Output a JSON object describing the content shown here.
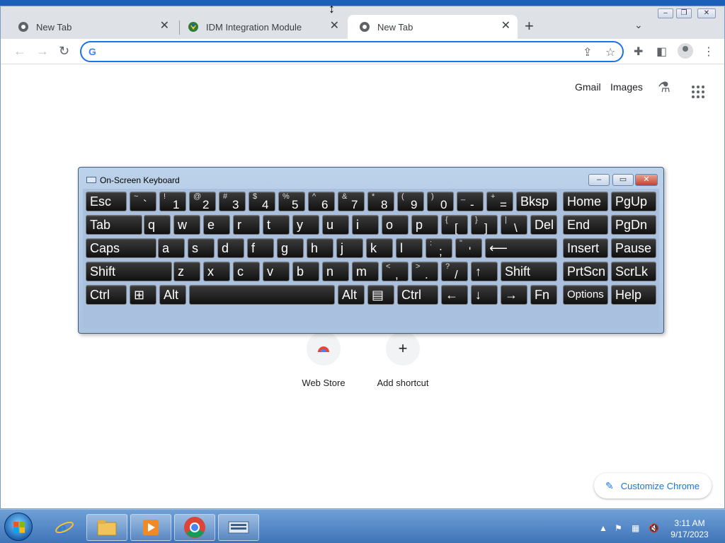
{
  "browser": {
    "tabs": [
      {
        "title": "New Tab",
        "active": false,
        "icon": "chrome-icon"
      },
      {
        "title": "IDM Integration Module",
        "active": false,
        "icon": "idm-icon"
      },
      {
        "title": "New Tab",
        "active": true,
        "icon": "chrome-icon"
      }
    ],
    "new_tab_symbol": "+",
    "omnibox": {
      "value": "",
      "placeholder": ""
    },
    "links": {
      "gmail": "Gmail",
      "images": "Images"
    }
  },
  "shortcuts": [
    {
      "label": "Web Store",
      "icon": "web-store-icon"
    },
    {
      "label": "Add shortcut",
      "icon": "plus-icon",
      "symbol": "+"
    }
  ],
  "customize_label": "Customize Chrome",
  "osk": {
    "title": "On-Screen Keyboard",
    "rows": [
      [
        {
          "label": "Esc"
        },
        {
          "shift": "~",
          "lower": "`"
        },
        {
          "shift": "!",
          "lower": "1"
        },
        {
          "shift": "@",
          "lower": "2"
        },
        {
          "shift": "#",
          "lower": "3"
        },
        {
          "shift": "$",
          "lower": "4"
        },
        {
          "shift": "%",
          "lower": "5"
        },
        {
          "shift": "^",
          "lower": "6"
        },
        {
          "shift": "&",
          "lower": "7"
        },
        {
          "shift": "*",
          "lower": "8"
        },
        {
          "shift": "(",
          "lower": "9"
        },
        {
          "shift": ")",
          "lower": "0"
        },
        {
          "shift": "_",
          "lower": "-"
        },
        {
          "shift": "+",
          "lower": "="
        },
        {
          "label": "Bksp"
        },
        {
          "label": "Home"
        },
        {
          "label": "PgUp"
        }
      ],
      [
        {
          "label": "Tab"
        },
        {
          "label": "q"
        },
        {
          "label": "w"
        },
        {
          "label": "e"
        },
        {
          "label": "r"
        },
        {
          "label": "t"
        },
        {
          "label": "y"
        },
        {
          "label": "u"
        },
        {
          "label": "i"
        },
        {
          "label": "o"
        },
        {
          "label": "p"
        },
        {
          "shift": "{",
          "lower": "["
        },
        {
          "shift": "}",
          "lower": "]"
        },
        {
          "shift": "|",
          "lower": "\\"
        },
        {
          "label": "Del"
        },
        {
          "label": "End"
        },
        {
          "label": "PgDn"
        }
      ],
      [
        {
          "label": "Caps"
        },
        {
          "label": "a"
        },
        {
          "label": "s"
        },
        {
          "label": "d"
        },
        {
          "label": "f"
        },
        {
          "label": "g"
        },
        {
          "label": "h"
        },
        {
          "label": "j"
        },
        {
          "label": "k"
        },
        {
          "label": "l"
        },
        {
          "shift": ":",
          "lower": ";"
        },
        {
          "shift": "\"",
          "lower": "'"
        },
        {
          "label": "⟵"
        },
        {
          "label": "Insert"
        },
        {
          "label": "Pause"
        }
      ],
      [
        {
          "label": "Shift"
        },
        {
          "label": "z"
        },
        {
          "label": "x"
        },
        {
          "label": "c"
        },
        {
          "label": "v"
        },
        {
          "label": "b"
        },
        {
          "label": "n"
        },
        {
          "label": "m"
        },
        {
          "shift": "<",
          "lower": ","
        },
        {
          "shift": ">",
          "lower": "."
        },
        {
          "shift": "?",
          "lower": "/"
        },
        {
          "label": "↑"
        },
        {
          "label": "Shift"
        },
        {
          "label": "PrtScn"
        },
        {
          "label": "ScrLk"
        }
      ],
      [
        {
          "label": "Ctrl"
        },
        {
          "label": "⊞"
        },
        {
          "label": "Alt"
        },
        {
          "label": ""
        },
        {
          "label": "Alt"
        },
        {
          "label": "▤"
        },
        {
          "label": "Ctrl"
        },
        {
          "label": "←"
        },
        {
          "label": "↓"
        },
        {
          "label": "→"
        },
        {
          "label": "Fn"
        },
        {
          "label": "Options"
        },
        {
          "label": "Help"
        }
      ]
    ]
  },
  "taskbar": {
    "items": [
      "start-button",
      "internet-explorer",
      "file-explorer",
      "media-player",
      "chrome",
      "on-screen-keyboard"
    ],
    "clock": {
      "time": "3:11 AM",
      "date": "9/17/2023"
    }
  }
}
